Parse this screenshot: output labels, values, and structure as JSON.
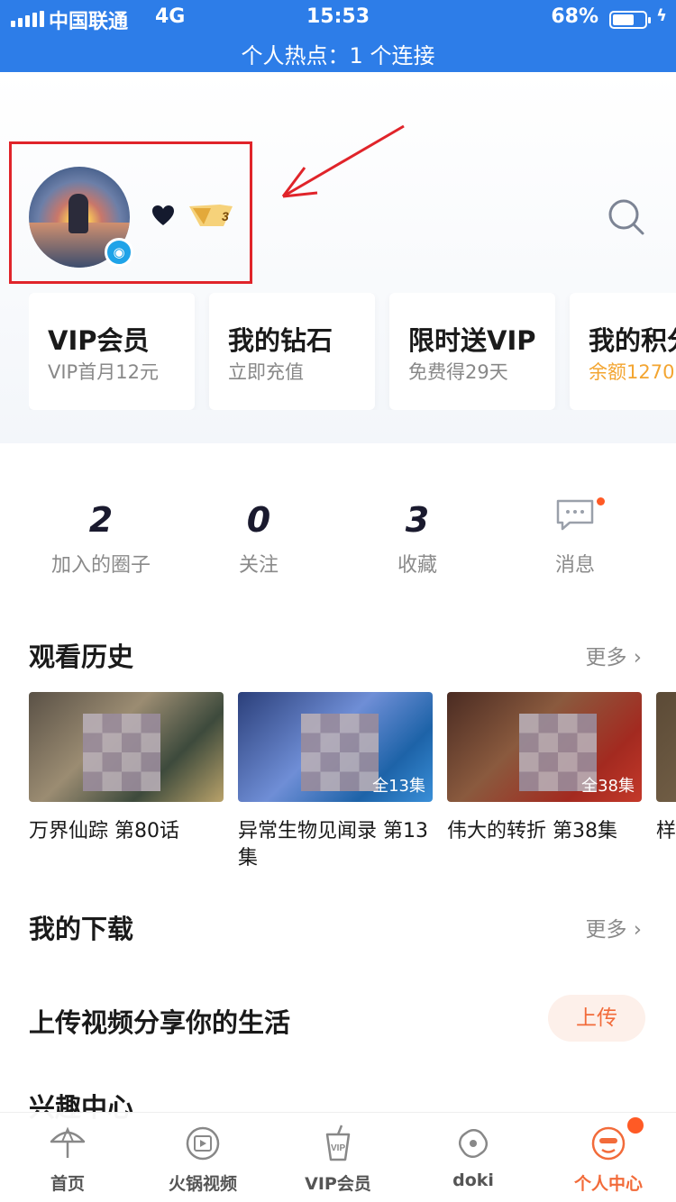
{
  "status_bar": {
    "carrier": "中国联通",
    "network": "4G",
    "time": "15:53",
    "battery": "68%",
    "battery_level": 0.68,
    "hotspot": "个人热点：1 个连接"
  },
  "profile": {
    "level_badge": "3",
    "icons": [
      "heart-icon",
      "vip-level-badge",
      "search-icon"
    ]
  },
  "cards": [
    {
      "title": "VIP会员",
      "subtitle": "VIP首月12元"
    },
    {
      "title": "我的钻石",
      "subtitle": "立即充值"
    },
    {
      "title": "限时送VIP",
      "subtitle": "免费得29天"
    },
    {
      "title": "我的积分",
      "subtitle": "余额1270"
    }
  ],
  "stats": [
    {
      "value": "2",
      "label": "加入的圈子"
    },
    {
      "value": "0",
      "label": "关注"
    },
    {
      "value": "3",
      "label": "收藏"
    }
  ],
  "messages": {
    "label": "消息"
  },
  "history": {
    "title": "观看历史",
    "more": "更多",
    "items": [
      {
        "caption": "万界仙踪 第80话",
        "episodes": ""
      },
      {
        "caption": "异常生物见闻录 第13集",
        "episodes": "全13集"
      },
      {
        "caption": "伟大的转折 第38集",
        "episodes": "全38集"
      },
      {
        "caption": "样",
        "episodes": ""
      }
    ]
  },
  "downloads": {
    "title": "我的下载",
    "more": "更多"
  },
  "upload": {
    "title": "上传视频分享你的生活",
    "button": "上传"
  },
  "interest": {
    "title": "兴趣中心"
  },
  "tabbar": {
    "tabs": [
      {
        "label": "首页",
        "icon": "umbrella-icon"
      },
      {
        "label": "火锅视频",
        "icon": "film-icon"
      },
      {
        "label": "VIP会员",
        "icon": "vip-cup-icon"
      },
      {
        "label": "doki",
        "icon": "doki-icon"
      },
      {
        "label": "个人中心",
        "icon": "profile-face-icon"
      }
    ]
  },
  "colors": {
    "status_bar": "#2d7de8",
    "accent": "#f26b3a",
    "highlight_box": "#e0242a",
    "gold": "#f3a531"
  }
}
